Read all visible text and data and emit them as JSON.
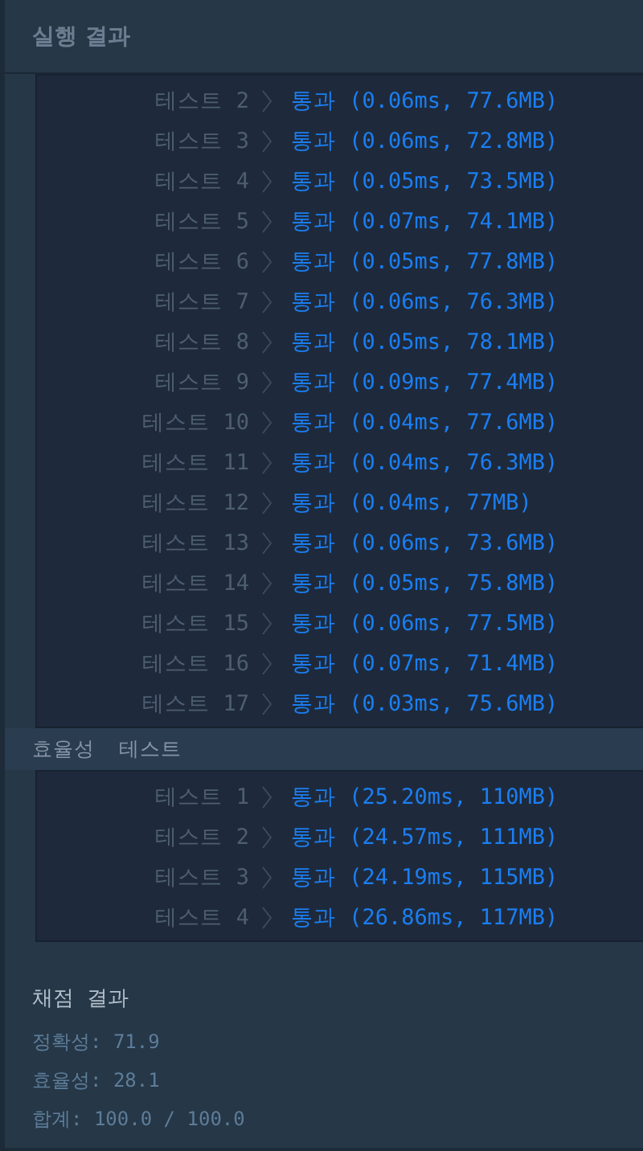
{
  "header": {
    "title": "실행 결과"
  },
  "accuracy_tests": [
    {
      "label": "테스트 2",
      "result": "통과 (0.06ms, 77.6MB)"
    },
    {
      "label": "테스트 3",
      "result": "통과 (0.06ms, 72.8MB)"
    },
    {
      "label": "테스트 4",
      "result": "통과 (0.05ms, 73.5MB)"
    },
    {
      "label": "테스트 5",
      "result": "통과 (0.07ms, 74.1MB)"
    },
    {
      "label": "테스트 6",
      "result": "통과 (0.05ms, 77.8MB)"
    },
    {
      "label": "테스트 7",
      "result": "통과 (0.06ms, 76.3MB)"
    },
    {
      "label": "테스트 8",
      "result": "통과 (0.05ms, 78.1MB)"
    },
    {
      "label": "테스트 9",
      "result": "통과 (0.09ms, 77.4MB)"
    },
    {
      "label": "테스트 10",
      "result": "통과 (0.04ms, 77.6MB)"
    },
    {
      "label": "테스트 11",
      "result": "통과 (0.04ms, 76.3MB)"
    },
    {
      "label": "테스트 12",
      "result": "통과 (0.04ms, 77MB)"
    },
    {
      "label": "테스트 13",
      "result": "통과 (0.06ms, 73.6MB)"
    },
    {
      "label": "테스트 14",
      "result": "통과 (0.05ms, 75.8MB)"
    },
    {
      "label": "테스트 15",
      "result": "통과 (0.06ms, 77.5MB)"
    },
    {
      "label": "테스트 16",
      "result": "통과 (0.07ms, 71.4MB)"
    },
    {
      "label": "테스트 17",
      "result": "통과 (0.03ms, 75.6MB)"
    }
  ],
  "efficiency_heading": "효율성  테스트",
  "efficiency_tests": [
    {
      "label": "테스트 1",
      "result": "통과 (25.20ms, 110MB)"
    },
    {
      "label": "테스트 2",
      "result": "통과 (24.57ms, 111MB)"
    },
    {
      "label": "테스트 3",
      "result": "통과 (24.19ms, 115MB)"
    },
    {
      "label": "테스트 4",
      "result": "통과 (26.86ms, 117MB)"
    }
  ],
  "score": {
    "title": "채점 결과",
    "lines": [
      "정확성: 71.9",
      "효율성: 28.1",
      "합계: 100.0 / 100.0"
    ]
  }
}
